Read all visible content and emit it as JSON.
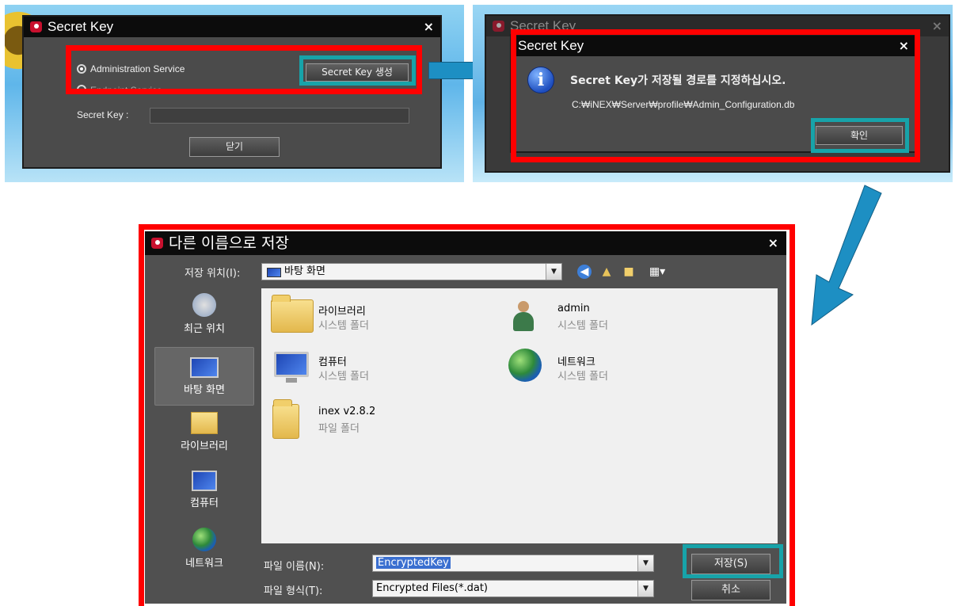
{
  "step1": {
    "title": "Secret Key",
    "close": "×",
    "radio_admin": "Administration Service",
    "radio_endpoint": "Endpoint Service",
    "generate_button": "Secret Key 생성",
    "secret_key_label": "Secret Key :",
    "secret_key_value": "",
    "close_button": "닫기"
  },
  "step2": {
    "bg_title": "Secret Key",
    "title": "Secret Key",
    "close": "×",
    "info_glyph": "i",
    "message": "Secret Key가 저장될 경로를 지정하십시오.",
    "path": "C:₩iNEX₩Server₩profile₩Admin_Configuration.db",
    "ok_button": "확인"
  },
  "step3": {
    "title": "다른 이름으로 저장",
    "close": "×",
    "location_label": "저장 위치(I):",
    "location_value": "바탕 화면",
    "places": [
      {
        "label": "최근 위치"
      },
      {
        "label": "바탕 화면"
      },
      {
        "label": "라이브러리"
      },
      {
        "label": "컴퓨터"
      },
      {
        "label": "네트워크"
      }
    ],
    "items": [
      {
        "name": "라이브러리",
        "type": "시스템 폴더"
      },
      {
        "name": "admin",
        "type": "시스템 폴더"
      },
      {
        "name": "컴퓨터",
        "type": "시스템 폴더"
      },
      {
        "name": "네트워크",
        "type": "시스템 폴더"
      },
      {
        "name": "inex v2.8.2",
        "type": "파일 폴더"
      }
    ],
    "filename_label": "파일 이름(N):",
    "filename_value": "EncryptedKey",
    "filetype_label": "파일 형식(T):",
    "filetype_value": "Encrypted Files(*.dat)",
    "save_button": "저장(S)",
    "cancel_button": "취소"
  },
  "colors": {
    "highlight_red": "#ff0000",
    "highlight_teal": "#17a3a9",
    "arrow_blue": "#1d8fc3",
    "dialog_bg": "#4b4b4b",
    "titlebar": "#0c0c0c"
  }
}
